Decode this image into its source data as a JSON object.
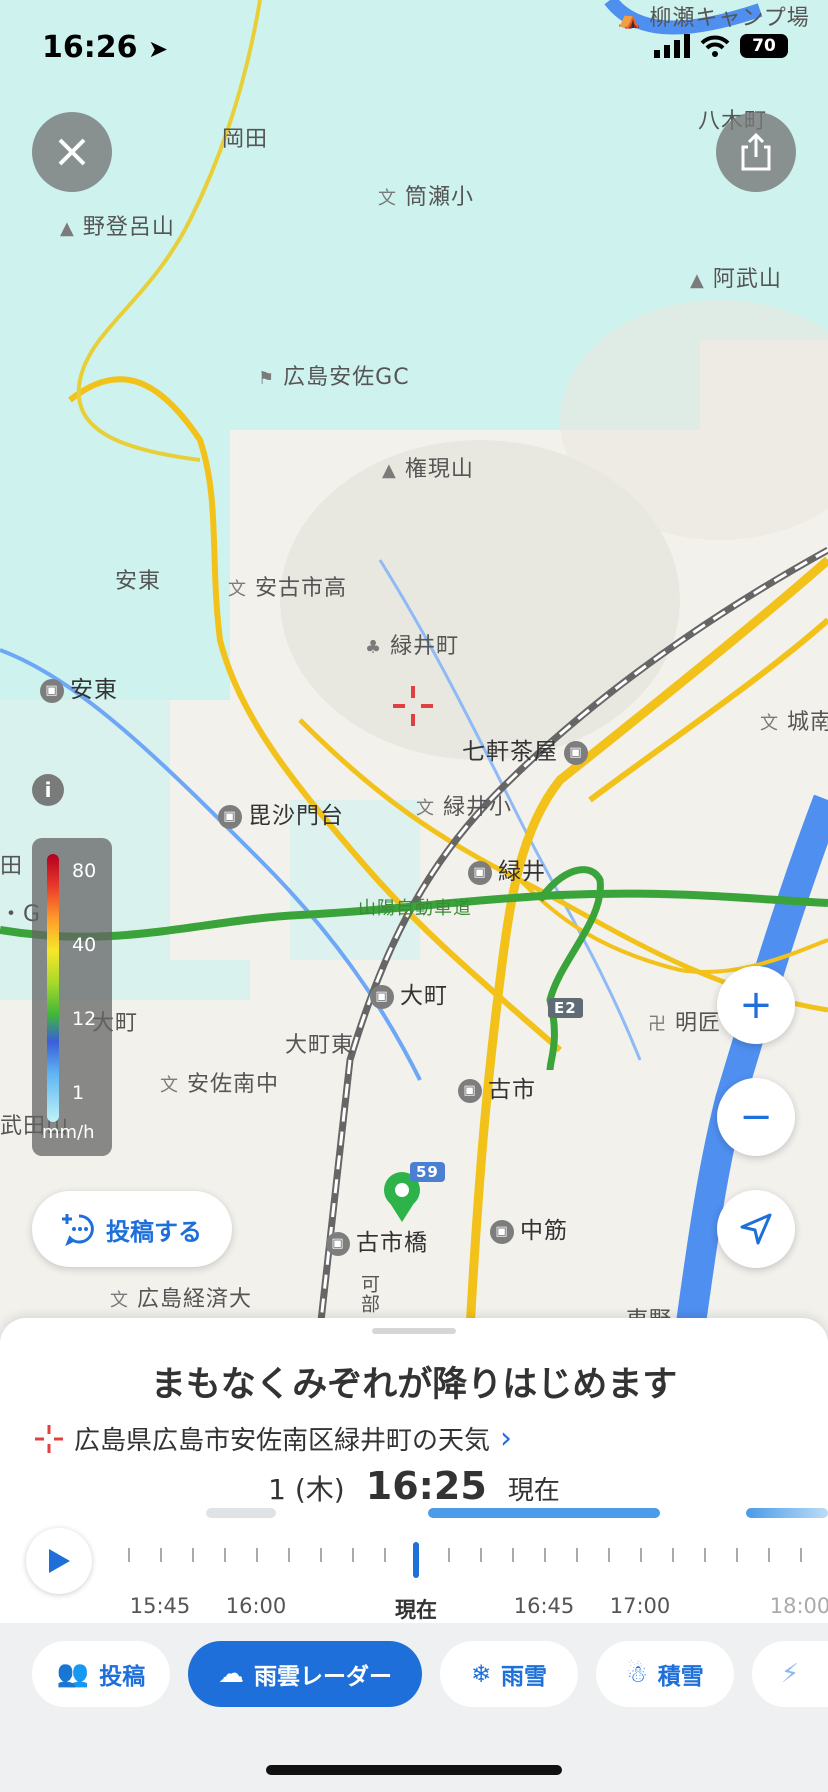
{
  "status_bar": {
    "time": "16:26",
    "battery": "70"
  },
  "map": {
    "labels": [
      {
        "text": "柳瀬キャンプ場",
        "kind": "poi"
      },
      {
        "text": "岡田",
        "kind": "place"
      },
      {
        "text": "八木町",
        "kind": "place"
      },
      {
        "text": "筒瀬小",
        "kind": "school"
      },
      {
        "text": "野登呂山",
        "kind": "mountain"
      },
      {
        "text": "阿武山",
        "kind": "mountain"
      },
      {
        "text": "広島安佐GC",
        "kind": "golf"
      },
      {
        "text": "権現山",
        "kind": "mountain"
      },
      {
        "text": "安東",
        "kind": "place"
      },
      {
        "text": "安古市高",
        "kind": "school"
      },
      {
        "text": "緑井町",
        "kind": "place"
      },
      {
        "text": "安東",
        "kind": "station"
      },
      {
        "text": "七軒茶屋",
        "kind": "station"
      },
      {
        "text": "城南",
        "kind": "school"
      },
      {
        "text": "毘沙門台",
        "kind": "station"
      },
      {
        "text": "緑井小",
        "kind": "school"
      },
      {
        "text": "緑井",
        "kind": "station"
      },
      {
        "text": "山陽自動車道",
        "kind": "road"
      },
      {
        "text": "大町",
        "kind": "station"
      },
      {
        "text": "大町",
        "kind": "place"
      },
      {
        "text": "大町東",
        "kind": "place"
      },
      {
        "text": "明匠",
        "kind": "temple"
      },
      {
        "text": "安佐南中",
        "kind": "school"
      },
      {
        "text": "古市",
        "kind": "station"
      },
      {
        "text": "古市橋",
        "kind": "station"
      },
      {
        "text": "中筋",
        "kind": "station"
      },
      {
        "text": "広島経済大",
        "kind": "school"
      },
      {
        "text": "東野",
        "kind": "place"
      },
      {
        "text": "田",
        "kind": "place"
      },
      {
        "text": "武田山",
        "kind": "place"
      },
      {
        "text": "・G",
        "kind": "place"
      },
      {
        "text": "可部",
        "kind": "place"
      },
      {
        "text": "E2",
        "kind": "shield"
      },
      {
        "text": "59",
        "kind": "shield"
      }
    ]
  },
  "legend": {
    "ticks": [
      "80",
      "40",
      "12",
      "1"
    ],
    "unit": "mm/h",
    "colors": [
      "#b00020",
      "#ff9a2a",
      "#f7e72a",
      "#3fb63a",
      "#3a5ed9",
      "#bff4f7"
    ]
  },
  "post_button": {
    "label": "投稿する"
  },
  "sheet": {
    "title": "まもなくみぞれが降りはじめます",
    "location": "広島県広島市安佐南区緑井町の天気",
    "date": "1 (木)",
    "time": "16:25",
    "now": "現在",
    "timeline_labels": [
      "15:45",
      "16:00",
      "現在",
      "16:45",
      "17:00",
      "18:00"
    ]
  },
  "tabs": [
    {
      "label": "投稿",
      "icon": "people-icon"
    },
    {
      "label": "雨雲レーダー",
      "icon": "rain-cloud-icon"
    },
    {
      "label": "雨雪",
      "icon": "snow-rain-icon"
    },
    {
      "label": "積雪",
      "icon": "snowman-icon"
    },
    {
      "label": "",
      "icon": "lightning-icon"
    }
  ],
  "colors": {
    "accent": "#1e6fd9",
    "precip_light": "#c8f3ef",
    "road_yellow": "#f2c21b",
    "highway_green": "#3aa33a",
    "river": "#4f8ff0"
  }
}
